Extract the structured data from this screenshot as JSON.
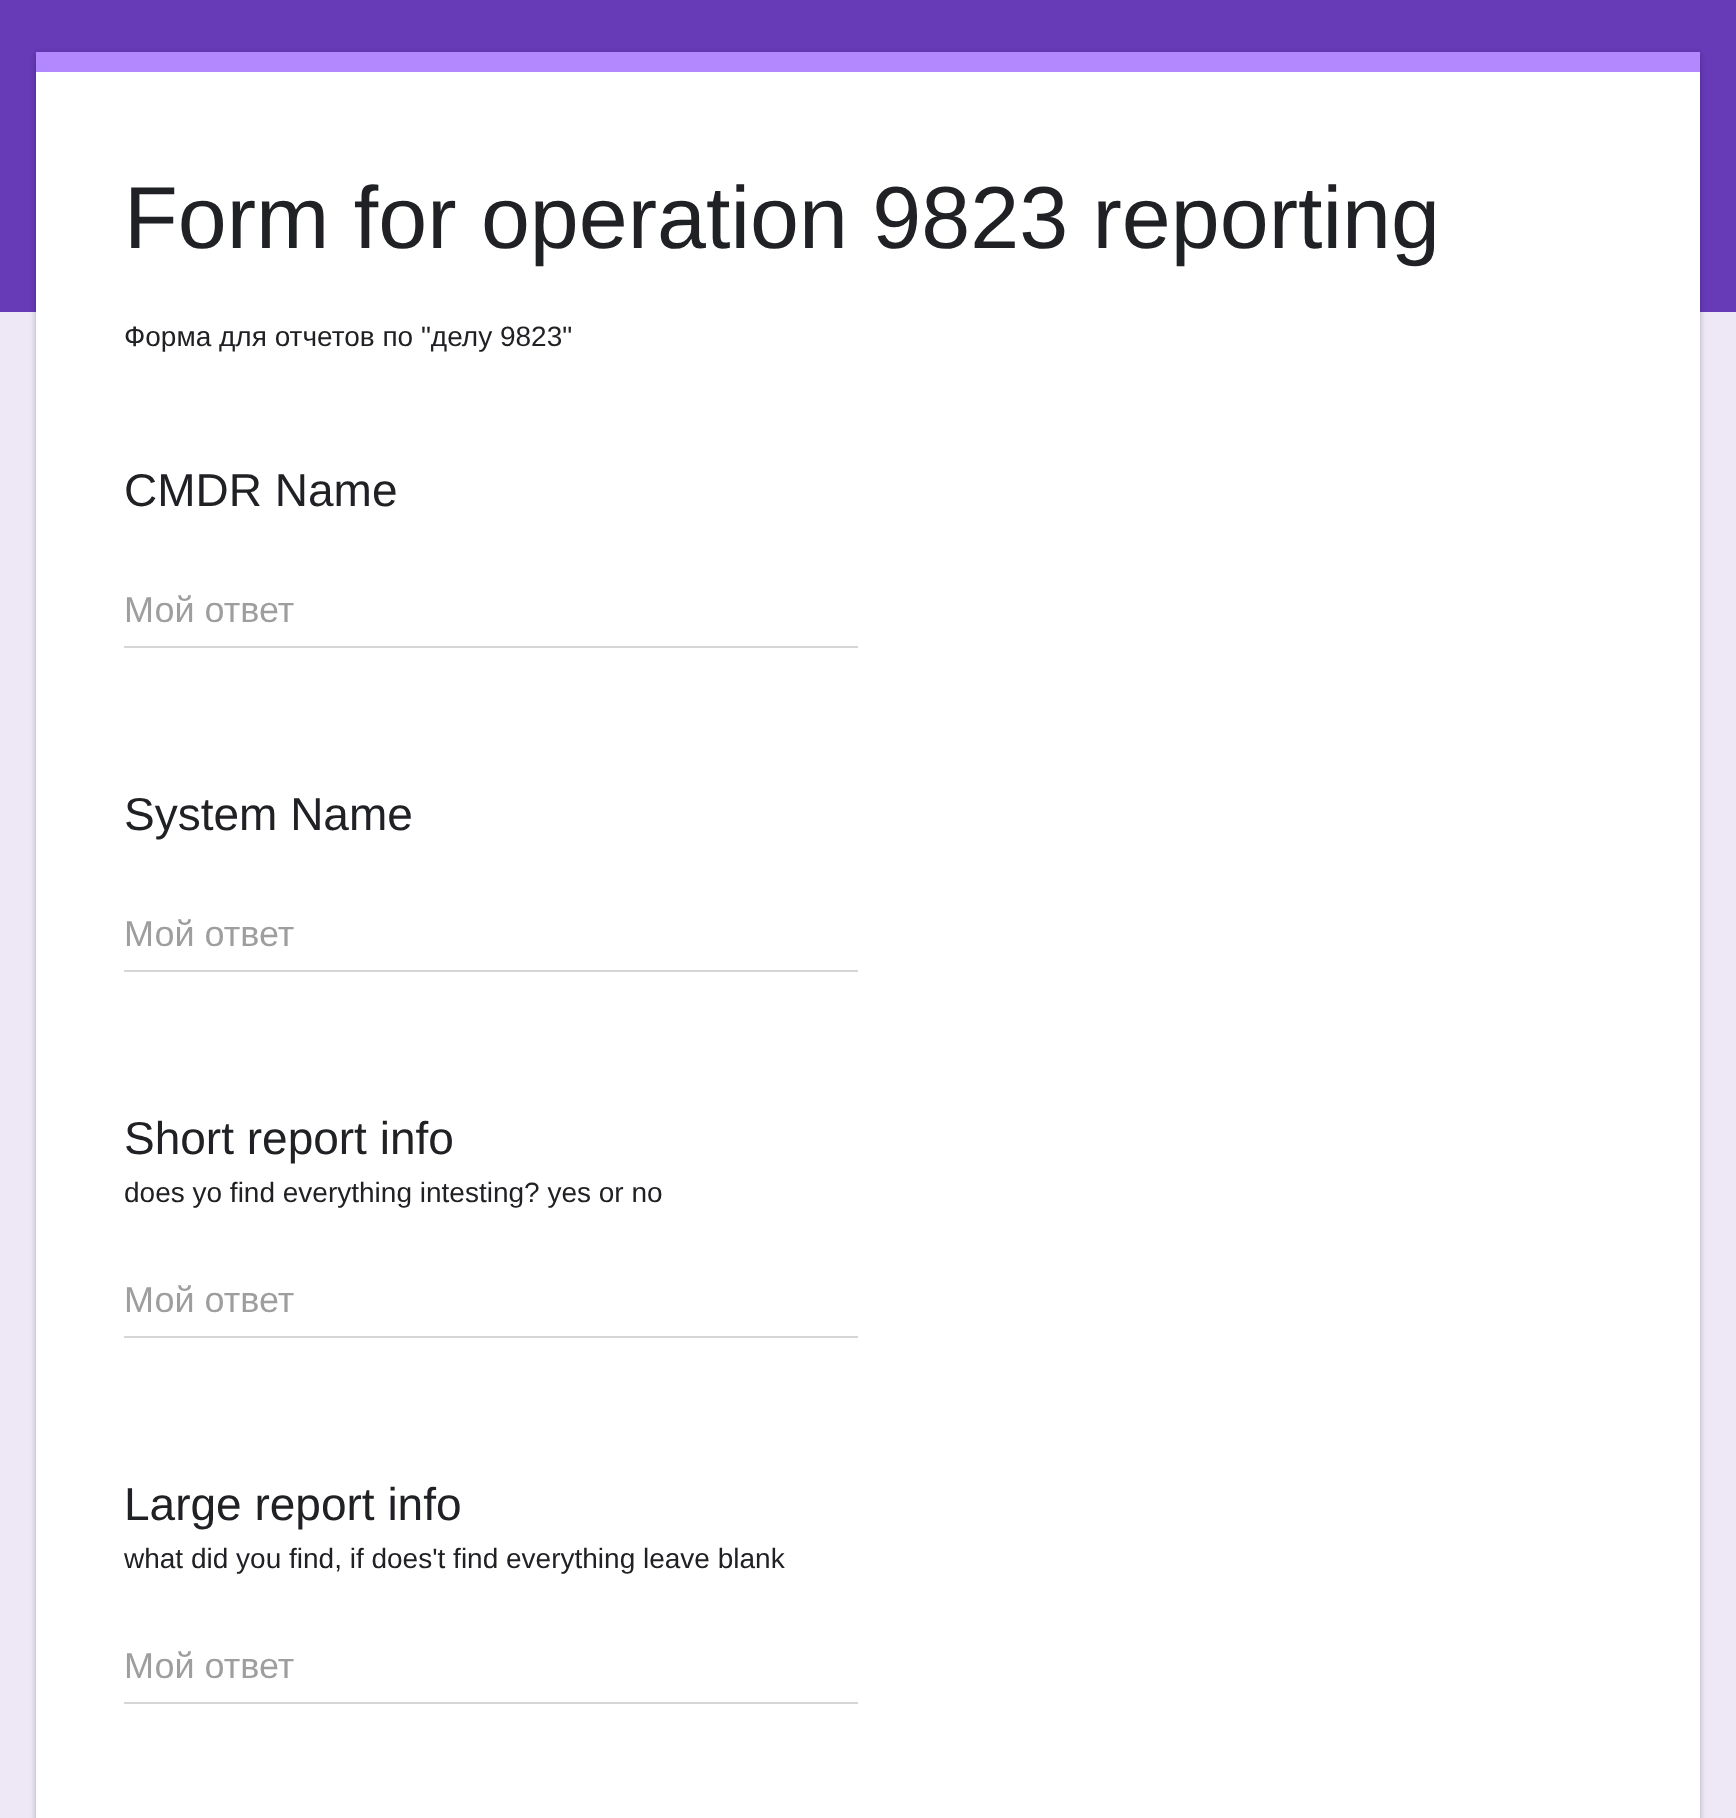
{
  "form": {
    "title": "Form for operation 9823 reporting",
    "description": "Форма для отчетов по \"делу 9823\""
  },
  "questions": [
    {
      "title": "CMDR Name",
      "placeholder": "Мой ответ"
    },
    {
      "title": "System Name",
      "placeholder": "Мой ответ"
    },
    {
      "title": "Short report info",
      "description": "does yo find everything intesting? yes or no",
      "placeholder": "Мой ответ"
    },
    {
      "title": "Large report info",
      "description": "what did you find, if does't find everything leave blank",
      "placeholder": "Мой ответ"
    }
  ]
}
